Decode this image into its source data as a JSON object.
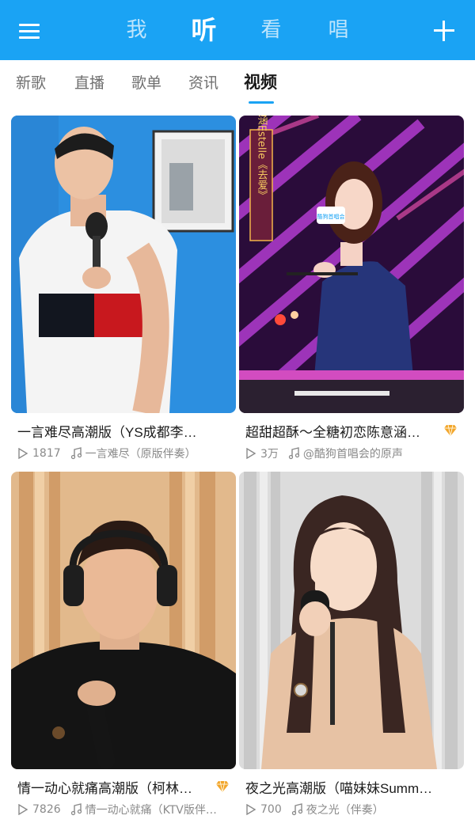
{
  "header": {
    "menu_icon": "hamburger-menu-icon",
    "add_icon": "plus-icon",
    "tabs": [
      {
        "label": "我"
      },
      {
        "label": "听"
      },
      {
        "label": "看"
      },
      {
        "label": "唱"
      }
    ],
    "active_tab": "听",
    "color": "#1aa3f4"
  },
  "subtabs": {
    "items": [
      {
        "label": "新歌"
      },
      {
        "label": "直播"
      },
      {
        "label": "歌单"
      },
      {
        "label": "资讯"
      },
      {
        "label": "视频"
      }
    ],
    "active": "视频"
  },
  "videos": [
    {
      "title": "一言难尽高潮版（YS成都李…",
      "plays": "1817",
      "song": "一言难尽（原版伴奏）",
      "badge": false
    },
    {
      "title": "超甜超酥～全糖初恋陈意涵…",
      "plays": "3万",
      "song": "@酷狗首唱会的原声",
      "badge": true,
      "thumb_text": "陈意涵Estelle《去爱》",
      "mic_text": "酷狗首唱会"
    },
    {
      "title": "情一动心就痛高潮版（柯林…",
      "plays": "7826",
      "song": "情一动心就痛（KTV版伴…",
      "badge": true
    },
    {
      "title": "夜之光高潮版（喵妹妹Summ…",
      "plays": "700",
      "song": "夜之光（伴奏）",
      "badge": false
    }
  ]
}
